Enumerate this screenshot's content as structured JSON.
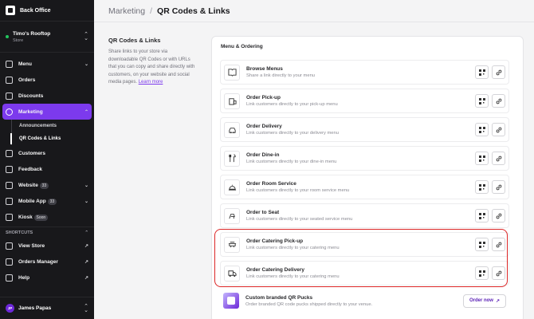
{
  "app": {
    "name": "Back Office"
  },
  "store": {
    "name": "Timo's Rooftop",
    "type": "Store"
  },
  "nav": {
    "menu": "Menu",
    "orders": "Orders",
    "discounts": "Discounts",
    "marketing": "Marketing",
    "sub_announcements": "Announcements",
    "sub_qr": "QR Codes & Links",
    "customers": "Customers",
    "feedback": "Feedback",
    "website": "Website",
    "website_badge": "33",
    "mobile_app": "Mobile App",
    "mobile_badge": "33",
    "kiosk": "Kiosk",
    "kiosk_badge": "Soon",
    "shortcuts": "SHORTCUTS",
    "view_store": "View Store",
    "orders_manager": "Orders Manager",
    "help": "Help"
  },
  "user": {
    "initials": "JP",
    "name": "James Papas"
  },
  "header": {
    "crumb1": "Marketing",
    "separator": "/",
    "crumb2": "QR Codes & Links"
  },
  "intro": {
    "title": "QR Codes & Links",
    "text": "Share links to your store via downloadable QR Codes or with URLs that you can copy and share directly with customers, on your website and social media pages.",
    "link": "Learn more"
  },
  "card": {
    "title": "Menu & Ordering",
    "rows": [
      {
        "title": "Browse Menus",
        "desc": "Share a link directly to your menu"
      },
      {
        "title": "Order Pick-up",
        "desc": "Link customers directly to your pick-up menu"
      },
      {
        "title": "Order Delivery",
        "desc": "Link customers directly to your delivery menu"
      },
      {
        "title": "Order Dine-in",
        "desc": "Link customers directly to your dine-in menu"
      },
      {
        "title": "Order Room Service",
        "desc": "Link customers directly to your room service menu"
      },
      {
        "title": "Order to Seat",
        "desc": "Link customers directly to your seated service menu"
      },
      {
        "title": "Order Catering Pick-up",
        "desc": "Link customers directly to your catering menu"
      },
      {
        "title": "Order Catering Delivery",
        "desc": "Link customers directly to your catering menu"
      }
    ],
    "puck": {
      "title": "Custom branded QR Pucks",
      "desc": "Order branded QR code pucks shipped directly to your venue.",
      "button": "Order now"
    }
  },
  "colors": {
    "accent": "#7c3aed",
    "sidebar": "#18181b",
    "highlight": "#dc2626"
  }
}
